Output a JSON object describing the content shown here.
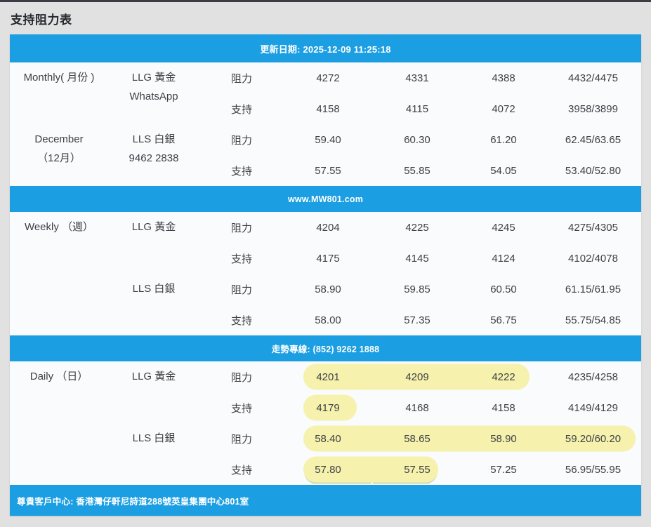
{
  "page": {
    "title": "支持阻力表",
    "background_color": "#e1e1e1",
    "accent_blue": "#1b9ee2",
    "highlight_yellow": "#f6f2ad"
  },
  "bars": {
    "update": "更新日期: 2025-12-09 11:25:18",
    "website": "www.MW801.com",
    "hotline": "走勢專線: (852) 9262 1888",
    "footer": "尊貴客戶中心: 香港灣仔軒尼詩道288號英皇集團中心801室"
  },
  "labels": {
    "resistance": "阻力",
    "support": "支持"
  },
  "sections": [
    {
      "pairs": [
        {
          "period": [
            "Monthly( 月份 )",
            ""
          ],
          "product": [
            "LLG 黃金",
            "WhatsApp"
          ],
          "resistance": [
            "4272",
            "4331",
            "4388",
            "4432/4475"
          ],
          "support": [
            "4158",
            "4115",
            "4072",
            "3958/3899"
          ],
          "highlight": {
            "resistance": [],
            "support": []
          }
        },
        {
          "period": [
            "December",
            "（12月）"
          ],
          "product": [
            "LLS 白銀",
            "9462 2838"
          ],
          "resistance": [
            "59.40",
            "60.30",
            "61.20",
            "62.45/63.65"
          ],
          "support": [
            "57.55",
            "55.85",
            "54.05",
            "53.40/52.80"
          ],
          "highlight": {
            "resistance": [],
            "support": []
          }
        }
      ]
    },
    {
      "pairs": [
        {
          "period": [
            "Weekly （週）",
            ""
          ],
          "product": [
            "LLG 黃金",
            ""
          ],
          "resistance": [
            "4204",
            "4225",
            "4245",
            "4275/4305"
          ],
          "support": [
            "4175",
            "4145",
            "4124",
            "4102/4078"
          ],
          "highlight": {
            "resistance": [],
            "support": []
          }
        },
        {
          "period": [
            "",
            ""
          ],
          "product": [
            "LLS 白銀",
            ""
          ],
          "resistance": [
            "58.90",
            "59.85",
            "60.50",
            "61.15/61.95"
          ],
          "support": [
            "58.00",
            "57.35",
            "56.75",
            "55.75/54.85"
          ],
          "highlight": {
            "resistance": [],
            "support": []
          }
        }
      ]
    },
    {
      "pairs": [
        {
          "period": [
            "Daily （日）",
            ""
          ],
          "product": [
            "LLG 黃金",
            ""
          ],
          "resistance": [
            "4201",
            "4209",
            "4222",
            "4235/4258"
          ],
          "support": [
            "4179",
            "4168",
            "4158",
            "4149/4129"
          ],
          "highlight": {
            "resistance": [
              0,
              1,
              2
            ],
            "support": [
              0
            ]
          }
        },
        {
          "period": [
            "",
            ""
          ],
          "product": [
            "LLS 白銀",
            ""
          ],
          "resistance": [
            "58.40",
            "58.65",
            "58.90",
            "59.20/60.20"
          ],
          "support": [
            "57.80",
            "57.55",
            "57.25",
            "56.95/55.95"
          ],
          "highlight": {
            "resistance": [
              0,
              1,
              2,
              3
            ],
            "support": [
              0,
              1
            ]
          }
        }
      ]
    }
  ]
}
